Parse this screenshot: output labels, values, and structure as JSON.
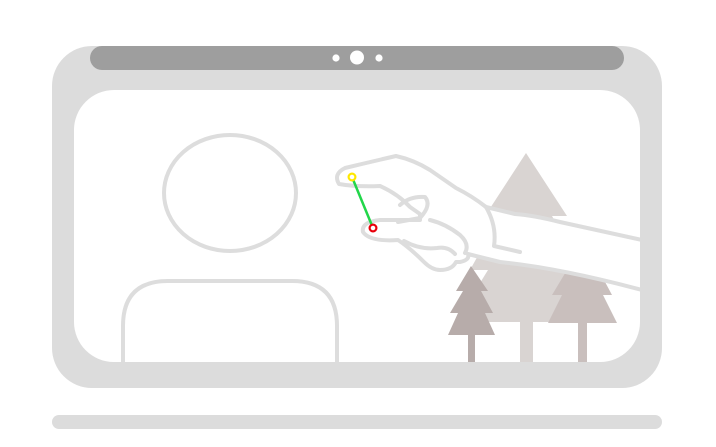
{
  "colors": {
    "frame": "#dcdcdc",
    "top_bar": "#9e9e9e",
    "camera_dots": "#ffffff",
    "screen": "#ffffff",
    "outline": "#dddddd",
    "tree_back": "#d9d4d2",
    "tree_mid": "#c9bfbd",
    "tree_front": "#b7acaa",
    "stand": "#dcdcdc",
    "pinch_line": "#22d64a",
    "thumb_marker": "#ffe800",
    "index_marker": "#e8000b"
  },
  "icons": {
    "camera": "camera-dots-icon",
    "person": "person-silhouette-icon",
    "hand": "pinching-hand-icon",
    "trees": "pine-tree-icon"
  }
}
